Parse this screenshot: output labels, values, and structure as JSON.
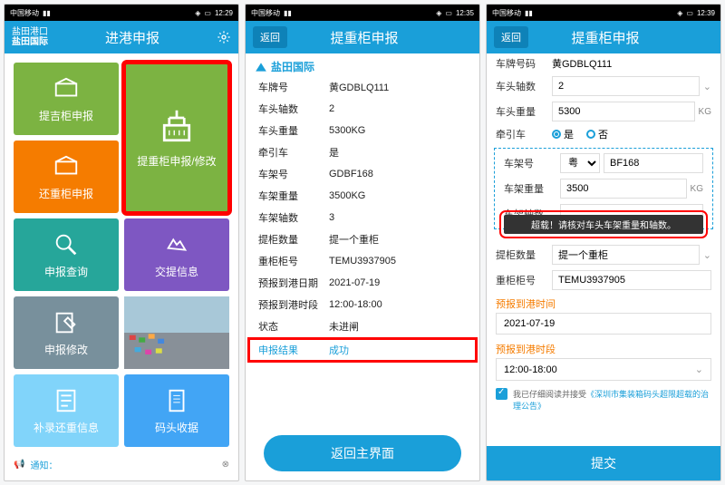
{
  "status": {
    "p1_time": "12:29",
    "p2_time": "12:35",
    "p3_time": "12:39"
  },
  "p1": {
    "logo_line1": "盐田港口",
    "logo_line2": "盐田国际",
    "title": "进港申报",
    "tiles": {
      "t1": "提吉柜申报",
      "t2": "提重柜申报/修改",
      "t3": "还重柜申报",
      "t4": "申报查询",
      "t5": "交提信息",
      "t6": "申报修改",
      "t7": "补录还重信息",
      "t8": "码头收据"
    },
    "notice_label": "通知："
  },
  "p2": {
    "back": "返回",
    "title": "提重柜申报",
    "brand": "盐田国际",
    "rows": {
      "plate_k": "车牌号",
      "plate_v": "黄GDBLQ111",
      "headaxle_k": "车头轴数",
      "headaxle_v": "2",
      "headwt_k": "车头重量",
      "headwt_v": "5300KG",
      "tractor_k": "牵引车",
      "tractor_v": "是",
      "frame_k": "车架号",
      "frame_v": "GDBF168",
      "framewt_k": "车架重量",
      "framewt_v": "3500KG",
      "frameaxle_k": "车架轴数",
      "frameaxle_v": "3",
      "qty_k": "提柜数量",
      "qty_v": "提一个重柜",
      "cntr_k": "重柜柜号",
      "cntr_v": "TEMU3937905",
      "date_k": "预报到港日期",
      "date_v": "2021-07-19",
      "slot_k": "预报到港时段",
      "slot_v": "12:00-18:00",
      "state_k": "状态",
      "state_v": "未进闸",
      "result_k": "申报结果",
      "result_v": "成功"
    },
    "main_btn": "返回主界面"
  },
  "p3": {
    "back": "返回",
    "title": "提重柜申报",
    "labels": {
      "plate": "车牌号码",
      "headaxle": "车头轴数",
      "headwt": "车头重量",
      "tractor": "牵引车",
      "yes": "是",
      "no": "否",
      "frame": "车架号",
      "frame_prefix": "粤",
      "framewt": "车架重量",
      "frameaxle": "车架轴数",
      "qty": "提柜数量",
      "cntr": "重柜柜号",
      "eta_date": "预报到港时间",
      "eta_slot": "预报到港时段",
      "agree_pre": "我已仔细阅读并接受",
      "agree_link": "《深圳市集装箱码头超限超载的治理公告》",
      "submit": "提交",
      "err": "超载！请核对车头车架重量和轴数。"
    },
    "values": {
      "plate": "黄GDBLQ111",
      "headaxle": "2",
      "headwt": "5300",
      "frame": "BF168",
      "framewt": "3500",
      "qty": "提一个重柜",
      "cntr": "TEMU3937905",
      "date": "2021-07-19",
      "slot": "12:00-18:00"
    },
    "unit_kg": "KG"
  }
}
